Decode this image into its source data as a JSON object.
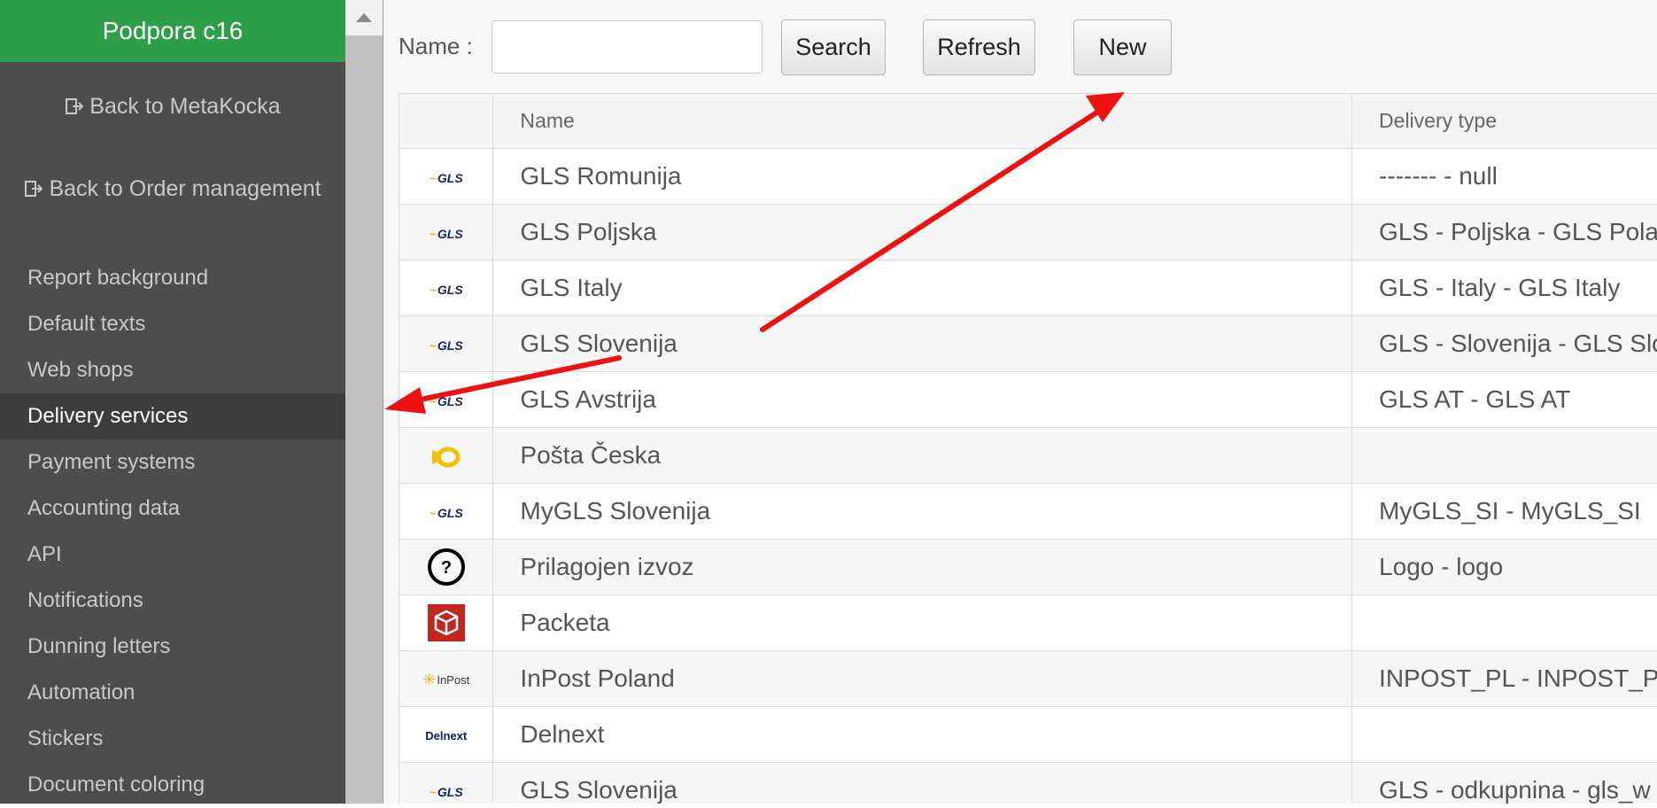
{
  "sidebar": {
    "brand": "Podpora c16",
    "back_metakocka": "Back to MetaKocka",
    "back_order_management": "Back to Order management",
    "items": [
      {
        "label": "Report background",
        "active": false
      },
      {
        "label": "Default texts",
        "active": false
      },
      {
        "label": "Web shops",
        "active": false
      },
      {
        "label": "Delivery services",
        "active": true
      },
      {
        "label": "Payment systems",
        "active": false
      },
      {
        "label": "Accounting data",
        "active": false
      },
      {
        "label": "API",
        "active": false
      },
      {
        "label": "Notifications",
        "active": false
      },
      {
        "label": "Dunning letters",
        "active": false
      },
      {
        "label": "Automation",
        "active": false
      },
      {
        "label": "Stickers",
        "active": false
      },
      {
        "label": "Document coloring",
        "active": false
      }
    ]
  },
  "toolbar": {
    "name_label": "Name :",
    "name_value": "",
    "search_label": "Search",
    "refresh_label": "Refresh",
    "new_label": "New"
  },
  "table": {
    "headers": [
      "",
      "Name",
      "Delivery type"
    ],
    "rows": [
      {
        "logo": "gls-logo",
        "name": "GLS Romunija",
        "type": "------- - null"
      },
      {
        "logo": "gls-logo",
        "name": "GLS Poljska",
        "type": "GLS - Poljska - GLS Pola"
      },
      {
        "logo": "gls-logo",
        "name": "GLS Italy",
        "type": "GLS - Italy - GLS Italy"
      },
      {
        "logo": "gls-logo",
        "name": "GLS Slovenija",
        "type": "GLS - Slovenija - GLS Slo"
      },
      {
        "logo": "gls-logo",
        "name": "GLS Avstrija",
        "type": "GLS AT - GLS AT"
      },
      {
        "logo": "posta-horn-logo",
        "name": "Pošta Česka",
        "type": ""
      },
      {
        "logo": "gls-logo",
        "name": "MyGLS Slovenija",
        "type": "MyGLS_SI - MyGLS_SI"
      },
      {
        "logo": "question-logo",
        "name": "Prilagojen izvoz",
        "type": "Logo - logo"
      },
      {
        "logo": "packeta-logo",
        "name": "Packeta",
        "type": ""
      },
      {
        "logo": "inpost-logo",
        "name": "InPost Poland",
        "type": "INPOST_PL - INPOST_PL"
      },
      {
        "logo": "delnext-logo",
        "name": "Delnext",
        "type": ""
      },
      {
        "logo": "gls-logo",
        "name": "GLS Slovenija",
        "type": "GLS - odkupnina - gls_w"
      }
    ]
  },
  "logo_text": {
    "gls": "GLS",
    "delnext": "Delnext",
    "inpost": "InPost"
  },
  "colors": {
    "brand_green": "#2e9e4a",
    "sidebar_bg": "#4d4d4d",
    "arrow_red": "#ee1111"
  }
}
